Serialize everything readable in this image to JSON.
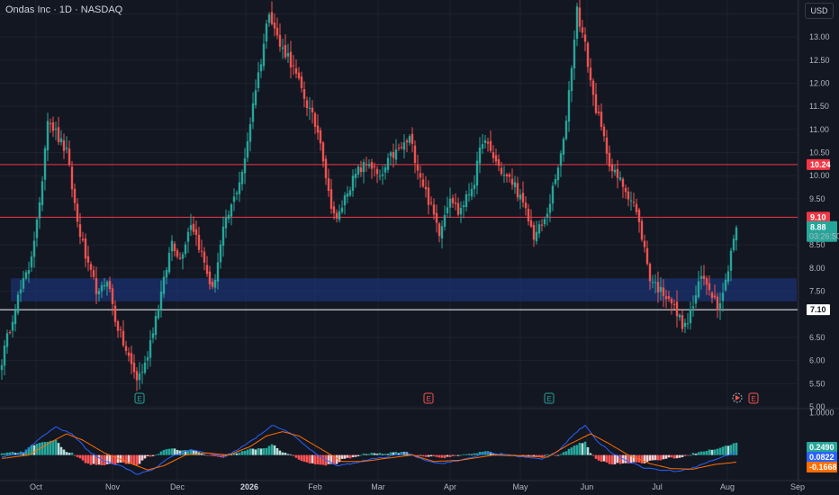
{
  "header": {
    "symbol_title": "Ondas Inc · 1D · NASDAQ",
    "currency": "USD"
  },
  "colors": {
    "background": "#131722",
    "up": "#26a69a",
    "down": "#ef5350",
    "grid": "#1e222d",
    "zone": "#1e3a8a",
    "resistance": "#f23645",
    "support": "#ffffff",
    "macd": "#2962ff",
    "signal": "#ff6d00",
    "hist_up_strong": "#26a69a",
    "hist_up_weak": "#b2dfdb",
    "hist_down_strong": "#ff5252",
    "hist_down_weak": "#ffcdd2"
  },
  "chart_data": [
    {
      "type": "candlestick",
      "title": "Ondas Inc · 1D · NASDAQ",
      "y_axis": {
        "range": [
          5.0,
          13.8
        ],
        "ticks": [
          "13.50",
          "13.00",
          "12.50",
          "12.00",
          "11.50",
          "11.00",
          "10.50",
          "10.00",
          "9.50",
          "8.50",
          "8.00",
          "7.50",
          "6.50",
          "6.00",
          "5.50",
          "5.00"
        ]
      },
      "x_axis": {
        "labels": [
          {
            "text": "Oct",
            "bold": false
          },
          {
            "text": "Nov",
            "bold": false
          },
          {
            "text": "Dec",
            "bold": false
          },
          {
            "text": "2026",
            "bold": true
          },
          {
            "text": "Feb",
            "bold": false
          },
          {
            "text": "Mar",
            "bold": false
          },
          {
            "text": "Apr",
            "bold": false
          },
          {
            "text": "May",
            "bold": false
          },
          {
            "text": "Jun",
            "bold": false
          },
          {
            "text": "Jul",
            "bold": false
          },
          {
            "text": "Aug",
            "bold": false
          },
          {
            "text": "Sep",
            "bold": false
          }
        ]
      },
      "horizontal_lines": [
        {
          "value": 10.24,
          "label": "10.24",
          "style": "resistance"
        },
        {
          "value": 9.1,
          "label": "9.10",
          "style": "resistance"
        },
        {
          "value": 7.1,
          "label": "7.10",
          "style": "support"
        }
      ],
      "zone": {
        "low": 7.28,
        "high": 7.78
      },
      "last_price": {
        "value": 8.88,
        "label": "8.88",
        "countdown": "03:26:50"
      },
      "events": [
        {
          "label": "E",
          "kind": "earnings-past"
        },
        {
          "label": "E",
          "kind": "earnings-negative"
        },
        {
          "label": "E",
          "kind": "earnings-past"
        },
        {
          "label": "E",
          "kind": "earnings-upcoming"
        }
      ],
      "anchors": [
        [
          0,
          6.0
        ],
        [
          5,
          7.2
        ],
        [
          10,
          8.0
        ],
        [
          14,
          9.3
        ],
        [
          17,
          11.3
        ],
        [
          21,
          10.8
        ],
        [
          24,
          10.5
        ],
        [
          28,
          9.0
        ],
        [
          32,
          8.0
        ],
        [
          36,
          7.4
        ],
        [
          39,
          7.8
        ],
        [
          42,
          6.9
        ],
        [
          46,
          6.2
        ],
        [
          50,
          5.6
        ],
        [
          53,
          5.9
        ],
        [
          56,
          6.7
        ],
        [
          60,
          7.7
        ],
        [
          63,
          8.6
        ],
        [
          66,
          8.2
        ],
        [
          70,
          9.0
        ],
        [
          72,
          8.7
        ],
        [
          75,
          8.1
        ],
        [
          78,
          7.5
        ],
        [
          82,
          8.8
        ],
        [
          86,
          9.5
        ],
        [
          90,
          10.3
        ],
        [
          93,
          11.6
        ],
        [
          96,
          12.5
        ],
        [
          99,
          13.6
        ],
        [
          103,
          12.8
        ],
        [
          106,
          12.6
        ],
        [
          110,
          12.0
        ],
        [
          114,
          11.4
        ],
        [
          118,
          10.8
        ],
        [
          121,
          9.6
        ],
        [
          124,
          9.0
        ],
        [
          128,
          9.7
        ],
        [
          132,
          10.1
        ],
        [
          136,
          10.3
        ],
        [
          140,
          9.9
        ],
        [
          144,
          10.4
        ],
        [
          148,
          10.6
        ],
        [
          151,
          10.8
        ],
        [
          155,
          10.0
        ],
        [
          159,
          9.3
        ],
        [
          162,
          8.8
        ],
        [
          166,
          9.6
        ],
        [
          169,
          9.2
        ],
        [
          172,
          9.5
        ],
        [
          175,
          9.9
        ],
        [
          178,
          10.8
        ],
        [
          182,
          10.4
        ],
        [
          186,
          10.0
        ],
        [
          190,
          9.8
        ],
        [
          194,
          9.2
        ],
        [
          197,
          8.7
        ],
        [
          201,
          9.0
        ],
        [
          205,
          9.9
        ],
        [
          208,
          10.7
        ],
        [
          211,
          12.4
        ],
        [
          213,
          13.6
        ],
        [
          216,
          12.8
        ],
        [
          219,
          11.7
        ],
        [
          222,
          11.0
        ],
        [
          226,
          10.1
        ],
        [
          230,
          9.8
        ],
        [
          234,
          9.4
        ],
        [
          237,
          8.7
        ],
        [
          240,
          7.8
        ],
        [
          244,
          7.5
        ],
        [
          247,
          7.4
        ],
        [
          250,
          7.0
        ],
        [
          253,
          6.7
        ],
        [
          256,
          7.2
        ],
        [
          259,
          7.8
        ],
        [
          262,
          7.6
        ],
        [
          265,
          7.2
        ],
        [
          268,
          7.7
        ],
        [
          270,
          8.4
        ],
        [
          272,
          8.9
        ]
      ],
      "last_candle": {
        "open": 8.6,
        "close": 8.88
      }
    },
    {
      "type": "macd",
      "y_axis": {
        "ticks": [
          "1.0000"
        ]
      },
      "values": {
        "histogram": "0.2490",
        "macd": "0.0822",
        "signal": "-0.1668"
      },
      "anchors": [
        [
          0,
          -0.05
        ],
        [
          8,
          0.05
        ],
        [
          14,
          0.4
        ],
        [
          20,
          0.65
        ],
        [
          26,
          0.5
        ],
        [
          32,
          0.1
        ],
        [
          38,
          -0.15
        ],
        [
          44,
          -0.25
        ],
        [
          50,
          -0.45
        ],
        [
          56,
          -0.35
        ],
        [
          62,
          -0.05
        ],
        [
          70,
          0.12
        ],
        [
          76,
          0.05
        ],
        [
          82,
          -0.05
        ],
        [
          88,
          0.15
        ],
        [
          94,
          0.4
        ],
        [
          100,
          0.7
        ],
        [
          106,
          0.55
        ],
        [
          112,
          0.25
        ],
        [
          118,
          -0.05
        ],
        [
          124,
          -0.25
        ],
        [
          130,
          -0.2
        ],
        [
          136,
          -0.1
        ],
        [
          142,
          -0.05
        ],
        [
          150,
          0.05
        ],
        [
          156,
          -0.1
        ],
        [
          162,
          -0.2
        ],
        [
          168,
          -0.15
        ],
        [
          174,
          -0.05
        ],
        [
          180,
          0.05
        ],
        [
          188,
          0.0
        ],
        [
          194,
          -0.05
        ],
        [
          200,
          -0.1
        ],
        [
          206,
          0.1
        ],
        [
          212,
          0.5
        ],
        [
          216,
          0.7
        ],
        [
          220,
          0.35
        ],
        [
          226,
          0.05
        ],
        [
          232,
          -0.15
        ],
        [
          238,
          -0.3
        ],
        [
          244,
          -0.35
        ],
        [
          250,
          -0.38
        ],
        [
          256,
          -0.3
        ],
        [
          262,
          -0.15
        ],
        [
          268,
          -0.02
        ],
        [
          272,
          0.0822
        ]
      ],
      "signal_anchors": [
        [
          0,
          -0.08
        ],
        [
          10,
          0.0
        ],
        [
          18,
          0.3
        ],
        [
          24,
          0.5
        ],
        [
          30,
          0.35
        ],
        [
          38,
          0.05
        ],
        [
          46,
          -0.15
        ],
        [
          54,
          -0.35
        ],
        [
          60,
          -0.25
        ],
        [
          68,
          0.0
        ],
        [
          76,
          0.05
        ],
        [
          84,
          0.0
        ],
        [
          92,
          0.2
        ],
        [
          98,
          0.45
        ],
        [
          104,
          0.55
        ],
        [
          110,
          0.45
        ],
        [
          118,
          0.15
        ],
        [
          126,
          -0.15
        ],
        [
          134,
          -0.15
        ],
        [
          142,
          -0.08
        ],
        [
          152,
          0.0
        ],
        [
          160,
          -0.15
        ],
        [
          170,
          -0.12
        ],
        [
          182,
          0.0
        ],
        [
          192,
          -0.02
        ],
        [
          202,
          -0.05
        ],
        [
          210,
          0.25
        ],
        [
          218,
          0.5
        ],
        [
          224,
          0.3
        ],
        [
          232,
          0.0
        ],
        [
          240,
          -0.2
        ],
        [
          248,
          -0.32
        ],
        [
          256,
          -0.33
        ],
        [
          264,
          -0.22
        ],
        [
          272,
          -0.1668
        ]
      ]
    }
  ]
}
